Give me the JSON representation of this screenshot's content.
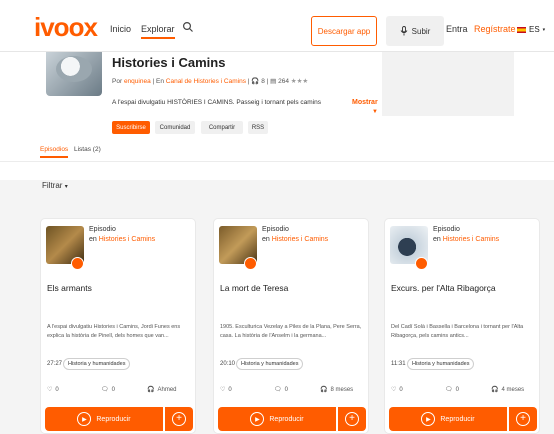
{
  "brand": {
    "logo": "ivoox",
    "accent": "#ff5c00"
  },
  "nav": {
    "home": "Inicio",
    "explore": "Explorar",
    "download_app": "Descargar app",
    "upload": "Subir",
    "login": "Entra",
    "register": "Regístrate",
    "lang": "ES"
  },
  "show": {
    "title": "Histories i Camins",
    "meta_prefix": "Por",
    "meta_author": "enquinea",
    "meta_in": "En",
    "meta_channel": "Canal de Histories i Camins",
    "meta_count1": "8",
    "meta_count2": "264",
    "description": "A l'espai divulgatiu HISTÒRIES I CAMINS. Passeig i tornant pels camins",
    "more": "Mostrar",
    "actions": {
      "subscribe": "Suscribirse",
      "community": "Comunidad",
      "share": "Compartir",
      "rss": "RSS"
    }
  },
  "tabs": {
    "episodes": "Episodios",
    "playlists": "Listas (2)"
  },
  "filter": "Filtrar",
  "episodes": [
    {
      "label": "Episodio",
      "in_prefix": "en",
      "podcast": "Histories i Camins",
      "title": "Els armants",
      "description": "A l'espai divulgatiu Histories i Camins, Jordi Funes ens explica la història de Pinell, dels homes que van... ",
      "duration": "27:27",
      "category": "Historia y humanidades",
      "likes": "0",
      "comments": "0",
      "plays": "Ahmed",
      "play_label": "Reproducir"
    },
    {
      "label": "Episodio",
      "in_prefix": "en",
      "podcast": "Histories i Camins",
      "title": "La mort de Teresa",
      "description": "1905. Esculturica Vezelay a Piles de la Plana, Pere Serra, casa. La història de l'Anselm i la germana... ",
      "duration": "20:10",
      "category": "Historia y humanidades",
      "likes": "0",
      "comments": "0",
      "plays": "8 meses",
      "play_label": "Reproducir"
    },
    {
      "label": "Episodio",
      "in_prefix": "en",
      "podcast": "Histories i Camins",
      "title": "Excurs. per l'Alta Ribagorça",
      "description": "Del Cadí Solà i Bassella i Barcelona i tornant per l'Alta Ribagorça, pels camins antics... ",
      "duration": "11:31",
      "category": "Historia y humanidades",
      "likes": "0",
      "comments": "0",
      "plays": "4 meses",
      "play_label": "Reproducir"
    }
  ]
}
